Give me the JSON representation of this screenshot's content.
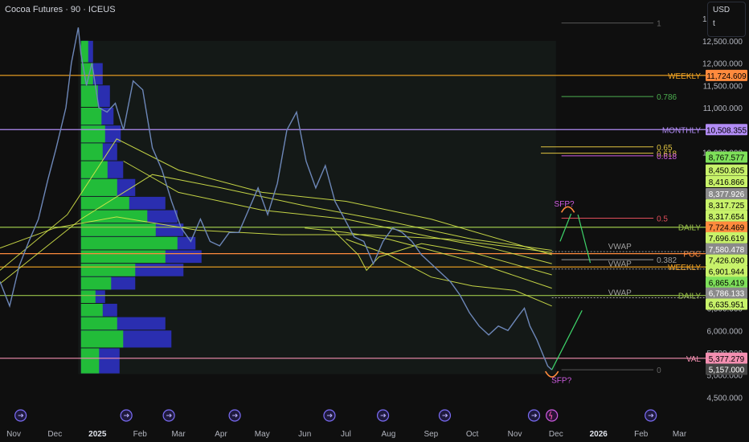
{
  "header": {
    "title": "Cocoa Futures · 90 · ICEUS",
    "currency": "USD",
    "currency_sub": "t"
  },
  "colors": {
    "weekly": "#f5a623",
    "monthly": "#b28cf5",
    "daily": "#9ac34a",
    "poc": "#ff8a3d",
    "val": "#f48fb1",
    "vwap": "#9e9e9e",
    "fib786": "#4caf50",
    "fib65": "#e0c341",
    "fib618": "#d05ce3",
    "fib05": "#e04e5a",
    "fib382": "#9e9e9e",
    "price": "#6d87b8"
  },
  "chart_data": {
    "type": "line",
    "ylim": [
      4400,
      13200
    ],
    "xlim": [
      "2024-10-22",
      "2026-03-20"
    ],
    "x_ticks": [
      {
        "label": "Nov",
        "date": "2024-11-01"
      },
      {
        "label": "Dec",
        "date": "2024-12-01"
      },
      {
        "label": "2025",
        "date": "2025-01-01"
      },
      {
        "label": "Feb",
        "date": "2025-02-01"
      },
      {
        "label": "Mar",
        "date": "2025-03-01"
      },
      {
        "label": "Apr",
        "date": "2025-04-01"
      },
      {
        "label": "May",
        "date": "2025-05-01"
      },
      {
        "label": "Jun",
        "date": "2025-06-01"
      },
      {
        "label": "Jul",
        "date": "2025-07-01"
      },
      {
        "label": "Aug",
        "date": "2025-08-01"
      },
      {
        "label": "Sep",
        "date": "2025-09-01"
      },
      {
        "label": "Oct",
        "date": "2025-10-01"
      },
      {
        "label": "Nov",
        "date": "2025-11-01"
      },
      {
        "label": "Dec",
        "date": "2025-12-01"
      },
      {
        "label": "2026",
        "date": "2026-01-01"
      },
      {
        "label": "Feb",
        "date": "2026-02-01"
      },
      {
        "label": "Mar",
        "date": "2026-03-01"
      }
    ],
    "y_ticks": [
      {
        "label": "13,000.000",
        "v": 13000
      },
      {
        "label": "12,500.000",
        "v": 12500
      },
      {
        "label": "12,000.000",
        "v": 12000
      },
      {
        "label": "11,500.000",
        "v": 11500
      },
      {
        "label": "11,000.000",
        "v": 11000
      },
      {
        "label": "10,000.000",
        "v": 10000
      },
      {
        "label": "6,500.000",
        "v": 6500
      },
      {
        "label": "6,000.000",
        "v": 6000
      },
      {
        "label": "5,500.000",
        "v": 5500
      },
      {
        "label": "5,000.000",
        "v": 5000
      },
      {
        "label": "4,500.000",
        "v": 4500
      }
    ],
    "series": [
      {
        "points": [
          [
            "2024-10-22",
            7100
          ],
          [
            "2024-10-29",
            6550
          ],
          [
            "2024-11-05",
            7450
          ],
          [
            "2024-11-12",
            8000
          ],
          [
            "2024-11-19",
            8500
          ],
          [
            "2024-11-26",
            9400
          ],
          [
            "2024-12-02",
            10100
          ],
          [
            "2024-12-09",
            11000
          ],
          [
            "2024-12-13",
            12000
          ],
          [
            "2024-12-18",
            12800
          ],
          [
            "2024-12-20",
            12200
          ],
          [
            "2024-12-24",
            11500
          ],
          [
            "2024-12-28",
            12000
          ],
          [
            "2025-01-02",
            11000
          ],
          [
            "2025-01-08",
            10900
          ],
          [
            "2025-01-14",
            11100
          ],
          [
            "2025-01-20",
            10500
          ],
          [
            "2025-01-27",
            11600
          ],
          [
            "2025-02-03",
            11400
          ],
          [
            "2025-02-10",
            10100
          ],
          [
            "2025-02-17",
            9600
          ],
          [
            "2025-02-24",
            8900
          ],
          [
            "2025-03-03",
            8300
          ],
          [
            "2025-03-10",
            8000
          ],
          [
            "2025-03-17",
            8500
          ],
          [
            "2025-03-24",
            8000
          ],
          [
            "2025-03-31",
            7900
          ],
          [
            "2025-04-07",
            8200
          ],
          [
            "2025-04-14",
            8200
          ],
          [
            "2025-04-21",
            8700
          ],
          [
            "2025-04-28",
            9200
          ],
          [
            "2025-05-05",
            8600
          ],
          [
            "2025-05-12",
            9300
          ],
          [
            "2025-05-19",
            10500
          ],
          [
            "2025-05-26",
            10900
          ],
          [
            "2025-06-02",
            9800
          ],
          [
            "2025-06-09",
            9200
          ],
          [
            "2025-06-16",
            9700
          ],
          [
            "2025-06-23",
            8900
          ],
          [
            "2025-06-30",
            8500
          ],
          [
            "2025-07-07",
            8100
          ],
          [
            "2025-07-14",
            8000
          ],
          [
            "2025-07-21",
            7500
          ],
          [
            "2025-07-28",
            8000
          ],
          [
            "2025-08-04",
            8300
          ],
          [
            "2025-08-11",
            8200
          ],
          [
            "2025-08-18",
            8000
          ],
          [
            "2025-08-25",
            7700
          ],
          [
            "2025-09-01",
            7500
          ],
          [
            "2025-09-08",
            7300
          ],
          [
            "2025-09-15",
            7100
          ],
          [
            "2025-09-22",
            6800
          ],
          [
            "2025-09-29",
            6400
          ],
          [
            "2025-10-06",
            6100
          ],
          [
            "2025-10-13",
            5900
          ],
          [
            "2025-10-20",
            6100
          ],
          [
            "2025-10-27",
            6000
          ],
          [
            "2025-11-03",
            6300
          ],
          [
            "2025-11-08",
            6500
          ],
          [
            "2025-11-12",
            6100
          ],
          [
            "2025-11-17",
            5800
          ],
          [
            "2025-11-21",
            5500
          ],
          [
            "2025-11-25",
            5200
          ],
          [
            "2025-11-28",
            5120
          ]
        ]
      }
    ],
    "moving_averages": [
      {
        "points": [
          [
            "2024-10-22",
            7350
          ],
          [
            "2024-12-10",
            8600
          ],
          [
            "2025-01-15",
            10300
          ],
          [
            "2025-03-01",
            9600
          ],
          [
            "2025-05-01",
            9100
          ],
          [
            "2025-07-01",
            8900
          ],
          [
            "2025-09-01",
            8500
          ],
          [
            "2025-11-01",
            7950
          ],
          [
            "2025-11-28",
            7700
          ]
        ]
      },
      {
        "points": [
          [
            "2024-10-22",
            7050
          ],
          [
            "2024-12-20",
            8500
          ],
          [
            "2025-02-10",
            9500
          ],
          [
            "2025-04-01",
            9200
          ],
          [
            "2025-06-01",
            8800
          ],
          [
            "2025-08-01",
            8450
          ],
          [
            "2025-10-01",
            8050
          ],
          [
            "2025-11-28",
            7800
          ]
        ]
      },
      {
        "points": [
          [
            "2024-10-22",
            7850
          ],
          [
            "2024-12-01",
            8300
          ],
          [
            "2025-01-15",
            8550
          ],
          [
            "2025-03-15",
            8250
          ],
          [
            "2025-05-15",
            8150
          ],
          [
            "2025-07-15",
            8150
          ],
          [
            "2025-09-15",
            8050
          ],
          [
            "2025-11-28",
            7750
          ]
        ]
      },
      {
        "points": [
          [
            "2025-01-20",
            9800
          ],
          [
            "2025-03-01",
            9100
          ],
          [
            "2025-05-01",
            8700
          ],
          [
            "2025-07-01",
            8500
          ],
          [
            "2025-09-01",
            8100
          ],
          [
            "2025-10-15",
            7850
          ],
          [
            "2025-11-28",
            7500
          ]
        ]
      },
      {
        "points": [
          [
            "2025-06-20",
            8300
          ],
          [
            "2025-07-10",
            7700
          ],
          [
            "2025-07-16",
            7350
          ],
          [
            "2025-07-25",
            7650
          ],
          [
            "2025-08-25",
            7950
          ],
          [
            "2025-10-01",
            7750
          ],
          [
            "2025-11-28",
            7250
          ]
        ]
      },
      {
        "points": [
          [
            "2025-06-01",
            8300
          ],
          [
            "2025-07-01",
            8200
          ],
          [
            "2025-08-01",
            8050
          ],
          [
            "2025-09-01",
            7800
          ],
          [
            "2025-10-01",
            7550
          ],
          [
            "2025-11-28",
            6950
          ]
        ]
      },
      {
        "points": [
          [
            "2025-07-01",
            8050
          ],
          [
            "2025-08-01",
            7700
          ],
          [
            "2025-09-01",
            7200
          ],
          [
            "2025-10-01",
            7000
          ],
          [
            "2025-11-01",
            6900
          ],
          [
            "2025-11-28",
            6550
          ]
        ]
      }
    ],
    "levels": [
      {
        "name": "WEEKLY",
        "value": 11724.609,
        "price_label": "11,724.609",
        "color_key": "weekly",
        "style": "solid",
        "x0": "2024-10-22"
      },
      {
        "name": "MONTHLY",
        "value": 10508.355,
        "price_label": "10,508.355",
        "color_key": "monthly",
        "style": "solid",
        "x0": "2024-10-22"
      },
      {
        "name": "DAILY",
        "value": 8317.725,
        "price_label": "8,317.725",
        "color_key": "daily",
        "style": "solid",
        "x0": "2024-10-22"
      },
      {
        "name": "POC",
        "value": 7724.469,
        "price_label": "7,724.469",
        "color_key": "poc",
        "style": "solid",
        "x0": "2024-10-22"
      },
      {
        "name": "WEEKLY",
        "value": 7426.09,
        "price_label": "7,426.090",
        "color_key": "weekly",
        "style": "solid",
        "x0": "2024-10-22"
      },
      {
        "name": "DAILY",
        "value": 6786.133,
        "price_label": "6,786.133",
        "color_key": "daily",
        "style": "solid",
        "x0": "2024-10-22"
      },
      {
        "name": "VAL",
        "value": 5377.279,
        "price_label": "5,377.279",
        "color_key": "val",
        "style": "solid",
        "x0": "2024-10-22"
      }
    ],
    "vwaps": [
      {
        "label": "VWAP",
        "value": 7770,
        "x0": "2025-11-28"
      },
      {
        "label": "VWAP",
        "value": 7380,
        "x0": "2025-11-28"
      },
      {
        "label": "VWAP",
        "value": 6735,
        "x0": "2025-11-28"
      }
    ],
    "fib_levels": [
      {
        "label": "1",
        "value": 12900,
        "color_key": "fib382",
        "x0": "2025-12-05",
        "x1": "2026-02-10"
      },
      {
        "label": "0.786",
        "value": 11250,
        "color_key": "fib786",
        "x0": "2025-12-05",
        "x1": "2026-02-10"
      },
      {
        "label": "0.65",
        "value": 10120,
        "color_key": "fib65",
        "x0": "2025-11-20",
        "x1": "2026-02-10"
      },
      {
        "label": "0.618",
        "value": 9980,
        "color_key": "fib65",
        "x0": "2025-11-20",
        "x1": "2026-02-10"
      },
      {
        "label": "0.618",
        "value": 9920,
        "color_key": "fib618",
        "x0": "2025-12-05",
        "x1": "2026-02-10"
      },
      {
        "label": "0.5",
        "value": 8520,
        "color_key": "fib05",
        "x0": "2025-12-05",
        "x1": "2026-02-10"
      },
      {
        "label": "0.382",
        "value": 7590,
        "color_key": "fib382",
        "x0": "2025-12-05",
        "x1": "2026-02-10"
      },
      {
        "label": "0",
        "value": 5120,
        "color_key": "fib382",
        "x0": "2025-12-05",
        "x1": "2026-02-10"
      }
    ],
    "right_labels": [
      {
        "text": "8,767.577",
        "value": 9890,
        "bg": "#7ee05a",
        "fg": "#000000"
      },
      {
        "text": "8,450.805",
        "value": 9600,
        "bg": "#c8f26a",
        "fg": "#000000"
      },
      {
        "text": "8,416.866",
        "value": 9340,
        "bg": "#c8f26a",
        "fg": "#000000"
      },
      {
        "text": "8,377.926",
        "value": 9070,
        "bg": "#8a8a8a",
        "fg": "#ffffff"
      },
      {
        "text": "8,317.725",
        "value": 8820,
        "bg": "#c8f26a",
        "fg": "#000000"
      },
      {
        "text": "8,317.654",
        "value": 8570,
        "bg": "#c8f26a",
        "fg": "#000000"
      },
      {
        "text": "7,724.469",
        "value": 8320,
        "bg": "#ff8a3d",
        "fg": "#000000"
      },
      {
        "text": "7,696.619",
        "value": 8080,
        "bg": "#c8f26a",
        "fg": "#000000"
      },
      {
        "text": "7,580.478",
        "value": 7830,
        "bg": "#8a8a8a",
        "fg": "#ffffff"
      },
      {
        "text": "7,426.090",
        "value": 7580,
        "bg": "#c8f26a",
        "fg": "#000000"
      },
      {
        "text": "6,901.944",
        "value": 7330,
        "bg": "#c8f26a",
        "fg": "#000000"
      },
      {
        "text": "6,865.419",
        "value": 7080,
        "bg": "#7ee05a",
        "fg": "#000000"
      },
      {
        "text": "6,786.133",
        "value": 6840,
        "bg": "#8a8a8a",
        "fg": "#ffffff"
      },
      {
        "text": "6,635.951",
        "value": 6590,
        "bg": "#c8f26a",
        "fg": "#000000"
      },
      {
        "text": "11,724.609",
        "value": 11724.609,
        "bg": "#ff8a3d",
        "fg": "#000000"
      },
      {
        "text": "10,508.355",
        "value": 10508.355,
        "bg": "#b28cf5",
        "fg": "#000000"
      },
      {
        "text": "5,377.279",
        "value": 5377.279,
        "bg": "#f48fb1",
        "fg": "#000000"
      },
      {
        "text": "5,157.000",
        "value": 5130,
        "bg": "#444444",
        "fg": "#ffffff"
      }
    ],
    "volume_profile": [
      {
        "y0": 5020,
        "y1": 5600,
        "green": 0.15,
        "blue": 0.32
      },
      {
        "y0": 5600,
        "y1": 6000,
        "green": 0.35,
        "blue": 0.75
      },
      {
        "y0": 6000,
        "y1": 6300,
        "green": 0.3,
        "blue": 0.7
      },
      {
        "y0": 6300,
        "y1": 6600,
        "green": 0.18,
        "blue": 0.3
      },
      {
        "y0": 6600,
        "y1": 6900,
        "green": 0.12,
        "blue": 0.2
      },
      {
        "y0": 6900,
        "y1": 7200,
        "green": 0.25,
        "blue": 0.45
      },
      {
        "y0": 7200,
        "y1": 7500,
        "green": 0.45,
        "blue": 0.85
      },
      {
        "y0": 7500,
        "y1": 7800,
        "green": 0.7,
        "blue": 1.0
      },
      {
        "y0": 7800,
        "y1": 8100,
        "green": 0.8,
        "blue": 0.95
      },
      {
        "y0": 8100,
        "y1": 8400,
        "green": 0.62,
        "blue": 0.85
      },
      {
        "y0": 8400,
        "y1": 8700,
        "green": 0.55,
        "blue": 0.8
      },
      {
        "y0": 8700,
        "y1": 9000,
        "green": 0.4,
        "blue": 0.7
      },
      {
        "y0": 9000,
        "y1": 9400,
        "green": 0.3,
        "blue": 0.45
      },
      {
        "y0": 9400,
        "y1": 9800,
        "green": 0.22,
        "blue": 0.35
      },
      {
        "y0": 9800,
        "y1": 10200,
        "green": 0.18,
        "blue": 0.3
      },
      {
        "y0": 10200,
        "y1": 10600,
        "green": 0.2,
        "blue": 0.33
      },
      {
        "y0": 10600,
        "y1": 11000,
        "green": 0.17,
        "blue": 0.27
      },
      {
        "y0": 11000,
        "y1": 11500,
        "green": 0.14,
        "blue": 0.24
      },
      {
        "y0": 11500,
        "y1": 12000,
        "green": 0.1,
        "blue": 0.18
      },
      {
        "y0": 12000,
        "y1": 12500,
        "green": 0.06,
        "blue": 0.1
      }
    ],
    "annotations": [
      {
        "text": "SFP?",
        "date": "2025-12-07",
        "value": 8780,
        "color": "#d05ce3"
      },
      {
        "text": "SFP?",
        "date": "2025-12-05",
        "value": 4820,
        "color": "#d05ce3"
      }
    ]
  }
}
